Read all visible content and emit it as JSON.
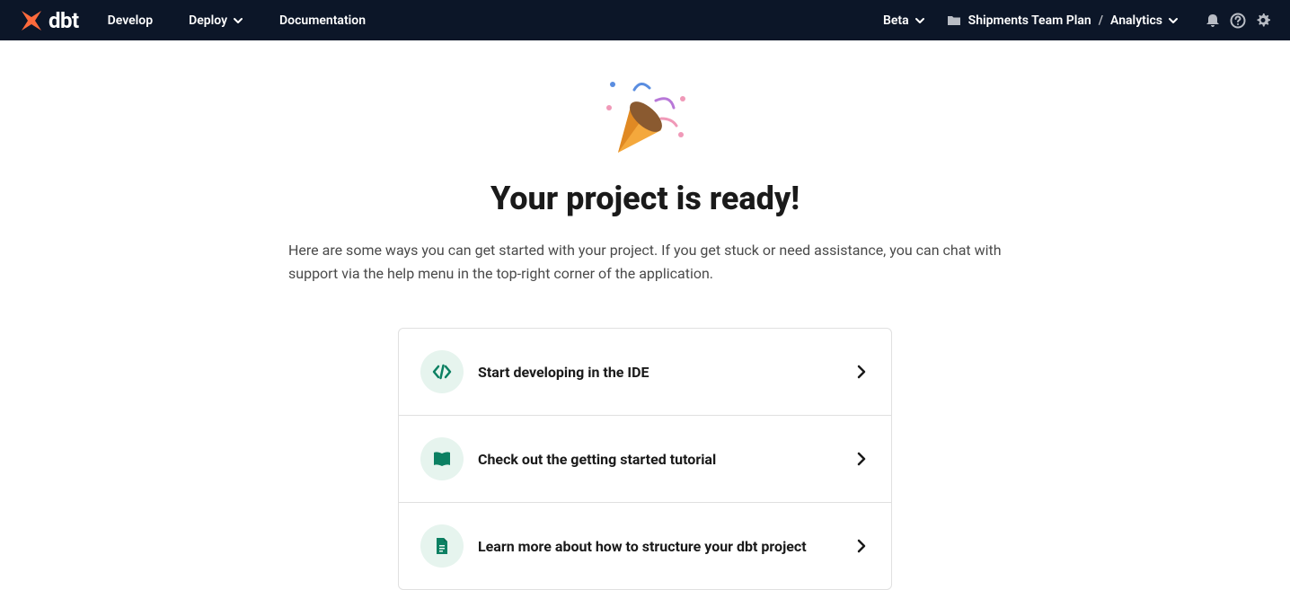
{
  "nav": {
    "develop": "Develop",
    "deploy": "Deploy",
    "documentation": "Documentation",
    "beta": "Beta",
    "plan": "Shipments Team Plan",
    "analytics": "Analytics"
  },
  "main": {
    "title": "Your project is ready!",
    "description": "Here are some ways you can get started with your project. If you get stuck or need assistance, you can chat with support via the help menu in the top-right corner of the application."
  },
  "actions": [
    {
      "label": "Start developing in the IDE"
    },
    {
      "label": "Check out the getting started tutorial"
    },
    {
      "label": "Learn more about how to structure your dbt project"
    }
  ]
}
